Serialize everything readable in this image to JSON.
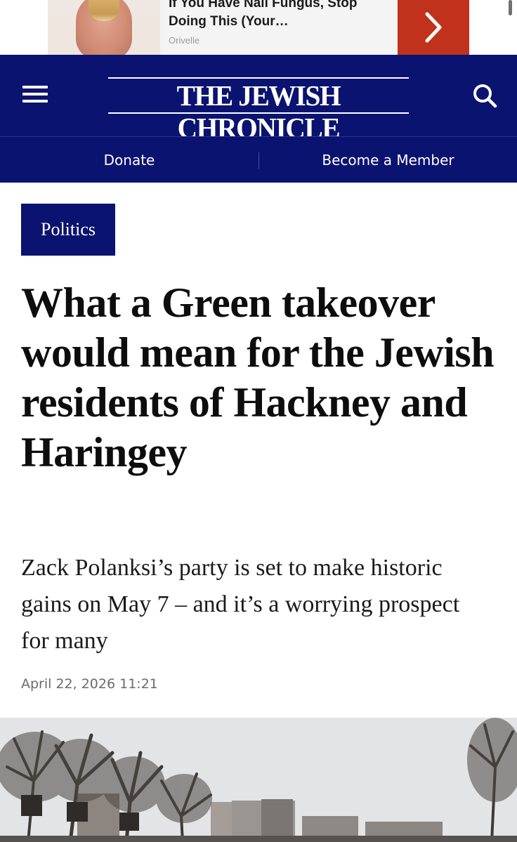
{
  "ad": {
    "title": "If You Have Nail Fungus, Stop Doing This (Your…",
    "source": "Orivelle",
    "cta_icon": "chevron-right-icon"
  },
  "header": {
    "logo": "THE JEWISH CHRONICLE",
    "menu_icon": "hamburger-menu-icon",
    "search_icon": "search-icon",
    "brand_color": "#0b1370"
  },
  "subnav": {
    "donate": "Donate",
    "member": "Become a Member"
  },
  "article": {
    "category": "Politics",
    "headline": "What a Green takeover would mean for the Jewish residents of Hackney and Haringey",
    "standfirst": "Zack Polanksi’s party is set to make historic gains on May 7 – and it’s a worrying prospect for many",
    "date": "April 22, 2026 11:21"
  }
}
